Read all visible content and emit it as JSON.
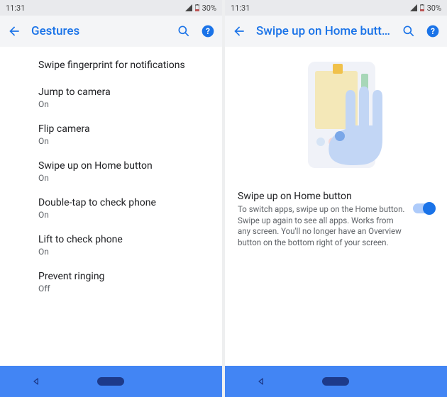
{
  "status": {
    "time": "11:31",
    "battery": "30%"
  },
  "left": {
    "title": "Gestures",
    "items": [
      {
        "title": "Swipe fingerprint for notifications",
        "sub": ""
      },
      {
        "title": "Jump to camera",
        "sub": "On"
      },
      {
        "title": "Flip camera",
        "sub": "On"
      },
      {
        "title": "Swipe up on Home button",
        "sub": "On"
      },
      {
        "title": "Double-tap to check phone",
        "sub": "On"
      },
      {
        "title": "Lift to check phone",
        "sub": "On"
      },
      {
        "title": "Prevent ringing",
        "sub": "Off"
      }
    ]
  },
  "right": {
    "title": "Swipe up on Home butt...",
    "detail_title": "Swipe up on Home button",
    "detail_desc": "To switch apps, swipe up on the Home button. Swipe up again to see all apps. Works from any screen. You'll no longer have an Overview button on the bottom right of your screen.",
    "toggle": true
  }
}
